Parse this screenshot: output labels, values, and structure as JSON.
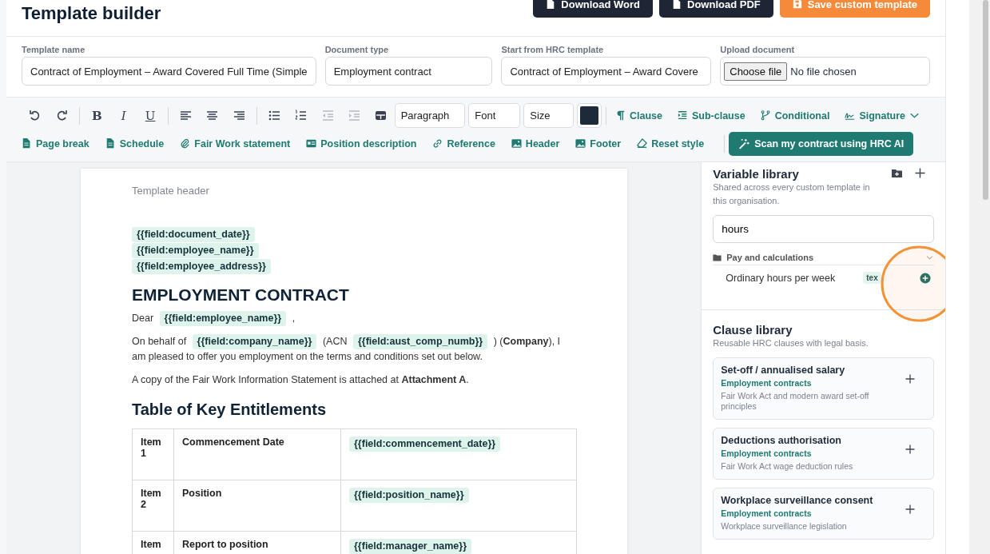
{
  "page_title": "Template builder",
  "header_buttons": [
    {
      "label": "Download Word",
      "kind": "word"
    },
    {
      "label": "Download PDF",
      "kind": "pdf"
    },
    {
      "label": "Save custom template",
      "kind": "save"
    }
  ],
  "fields": [
    {
      "label": "Template name",
      "kind": "text",
      "value": "Contract of Employment – Award Covered Full Time (Simple"
    },
    {
      "label": "Document type",
      "kind": "text",
      "value": "Employment contract"
    },
    {
      "label": "Start from HRC template",
      "kind": "text",
      "value": "Contract of Employment – Award Covere"
    },
    {
      "label": "Upload document",
      "kind": "file",
      "button": "Choose file",
      "value": "No file chosen"
    }
  ],
  "toolbar": {
    "format_tools": [
      {
        "kind": "undo",
        "disabled": false
      },
      {
        "kind": "redo",
        "disabled": false
      },
      {
        "kind": "sep"
      },
      {
        "kind": "bold",
        "label": "B",
        "disabled": false
      },
      {
        "kind": "italic",
        "label": "I",
        "disabled": false
      },
      {
        "kind": "underline",
        "label": "U",
        "disabled": false
      },
      {
        "kind": "sep"
      },
      {
        "kind": "align-left",
        "disabled": false
      },
      {
        "kind": "align-center",
        "disabled": false
      },
      {
        "kind": "align-right",
        "disabled": false
      },
      {
        "kind": "sep"
      },
      {
        "kind": "bullets",
        "disabled": false
      },
      {
        "kind": "numbers",
        "disabled": false
      },
      {
        "kind": "outdent",
        "disabled": true
      },
      {
        "kind": "indent",
        "disabled": true
      },
      {
        "kind": "table",
        "disabled": false
      }
    ],
    "selects": [
      {
        "value": "Paragraph"
      },
      {
        "value": "Font"
      },
      {
        "value": "Size"
      }
    ],
    "inserts_row1": [
      {
        "label": "Clause",
        "kind": "clause",
        "has_menu": false
      },
      {
        "label": "Sub-clause",
        "kind": "subclause",
        "has_menu": false
      },
      {
        "label": "Conditional",
        "kind": "conditional",
        "has_menu": false
      },
      {
        "label": "Signature",
        "kind": "signature",
        "has_menu": true
      }
    ],
    "inserts_row2": [
      {
        "label": "Page break",
        "kind": "pagebreak"
      },
      {
        "label": "Schedule",
        "kind": "schedule"
      },
      {
        "label": "Fair Work statement",
        "kind": "statement"
      },
      {
        "label": "Position description",
        "kind": "position"
      },
      {
        "label": "Reference",
        "kind": "reference"
      },
      {
        "label": "Header",
        "kind": "header"
      },
      {
        "label": "Footer",
        "kind": "footer"
      },
      {
        "label": "Reset style",
        "kind": "reset"
      }
    ],
    "ai_button": "Scan my contract using HRC AI"
  },
  "document": {
    "header_placeholder": "Template header",
    "address_tokens": [
      "{{field:document_date}}",
      "{{field:employee_name}}",
      "{{field:employee_address}}"
    ],
    "title": "EMPLOYMENT CONTRACT",
    "paragraphs": [
      [
        {
          "kind": "text",
          "text": "Dear"
        },
        {
          "kind": "field",
          "text": "{{field:employee_name}}"
        },
        {
          "kind": "text",
          "text": ","
        }
      ],
      [
        {
          "kind": "text",
          "text": "On behalf of"
        },
        {
          "kind": "field",
          "text": "{{field:company_name}}"
        },
        {
          "kind": "text",
          "text": "(ACN"
        },
        {
          "kind": "field",
          "text": "{{field:aust_comp_numb}}"
        },
        {
          "kind": "text",
          "text": ") (**Company**), I am pleased to offer you employment on the terms and conditions set out below."
        }
      ],
      [
        {
          "kind": "text",
          "text": "A copy of the Fair Work Information Statement is attached at **Attachment A**."
        }
      ]
    ],
    "table_title": "Table of Key Entitlements",
    "table_rows": [
      [
        "Item 1",
        "Commencement Date",
        "{{field:commencement_date}}"
      ],
      [
        "Item 2",
        "Position",
        "{{field:position_name}}"
      ],
      [
        "Item",
        "Report to position",
        "{{field:manager_name}}"
      ]
    ]
  },
  "variable_library": {
    "title": "Variable library",
    "subtitle": "Shared across every custom template in this organisation.",
    "search": "hours",
    "group": {
      "name": "Pay and calculations",
      "expanded": true,
      "items": [
        {
          "name": "Ordinary hours per week",
          "type": "tex"
        }
      ]
    }
  },
  "clause_library": {
    "title": "Clause library",
    "subtitle": "Reusable HRC clauses with legal basis.",
    "clauses": [
      {
        "title": "Set-off / annualised salary",
        "category": "Employment contracts",
        "basis": "Fair Work Act and modern award set-off principles"
      },
      {
        "title": "Deductions authorisation",
        "category": "Employment contracts",
        "basis": "Fair Work Act wage deduction rules"
      },
      {
        "title": "Workplace surveillance consent",
        "category": "Employment contracts",
        "basis": "Workplace surveillance legislation"
      }
    ]
  },
  "highlight": {
    "kind": "circle"
  }
}
